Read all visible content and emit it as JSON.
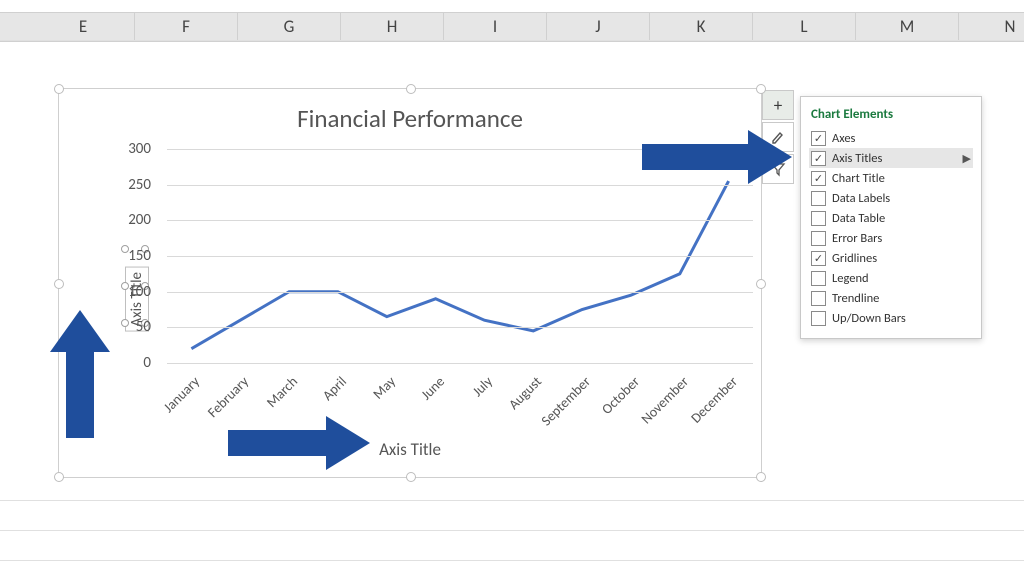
{
  "columns": [
    "E",
    "F",
    "G",
    "H",
    "I",
    "J",
    "K",
    "L",
    "M",
    "N"
  ],
  "chart": {
    "title": "Financial Performance",
    "x_axis_title": "Axis Title",
    "y_axis_title": "Axis Title"
  },
  "chart_data": {
    "type": "line",
    "title": "Financial Performance",
    "xlabel": "Axis Title",
    "ylabel": "Axis Title",
    "ylim": [
      0,
      300
    ],
    "yticks": [
      0,
      50,
      100,
      150,
      200,
      250,
      300
    ],
    "categories": [
      "January",
      "February",
      "March",
      "April",
      "May",
      "June",
      "July",
      "August",
      "September",
      "October",
      "November",
      "December"
    ],
    "values": [
      20,
      60,
      100,
      100,
      65,
      90,
      60,
      45,
      75,
      95,
      125,
      255
    ]
  },
  "side_buttons": {
    "plus": "+",
    "brush_icon": "brush-icon",
    "filter_icon": "filter-icon"
  },
  "flyout": {
    "heading": "Chart Elements",
    "items": [
      {
        "label": "Axes",
        "checked": true,
        "selected": false,
        "caret": false
      },
      {
        "label": "Axis Titles",
        "checked": true,
        "selected": true,
        "caret": true
      },
      {
        "label": "Chart Title",
        "checked": true,
        "selected": false,
        "caret": false
      },
      {
        "label": "Data Labels",
        "checked": false,
        "selected": false,
        "caret": false
      },
      {
        "label": "Data Table",
        "checked": false,
        "selected": false,
        "caret": false
      },
      {
        "label": "Error Bars",
        "checked": false,
        "selected": false,
        "caret": false
      },
      {
        "label": "Gridlines",
        "checked": true,
        "selected": false,
        "caret": false
      },
      {
        "label": "Legend",
        "checked": false,
        "selected": false,
        "caret": false
      },
      {
        "label": "Trendline",
        "checked": false,
        "selected": false,
        "caret": false
      },
      {
        "label": "Up/Down Bars",
        "checked": false,
        "selected": false,
        "caret": false
      }
    ]
  }
}
